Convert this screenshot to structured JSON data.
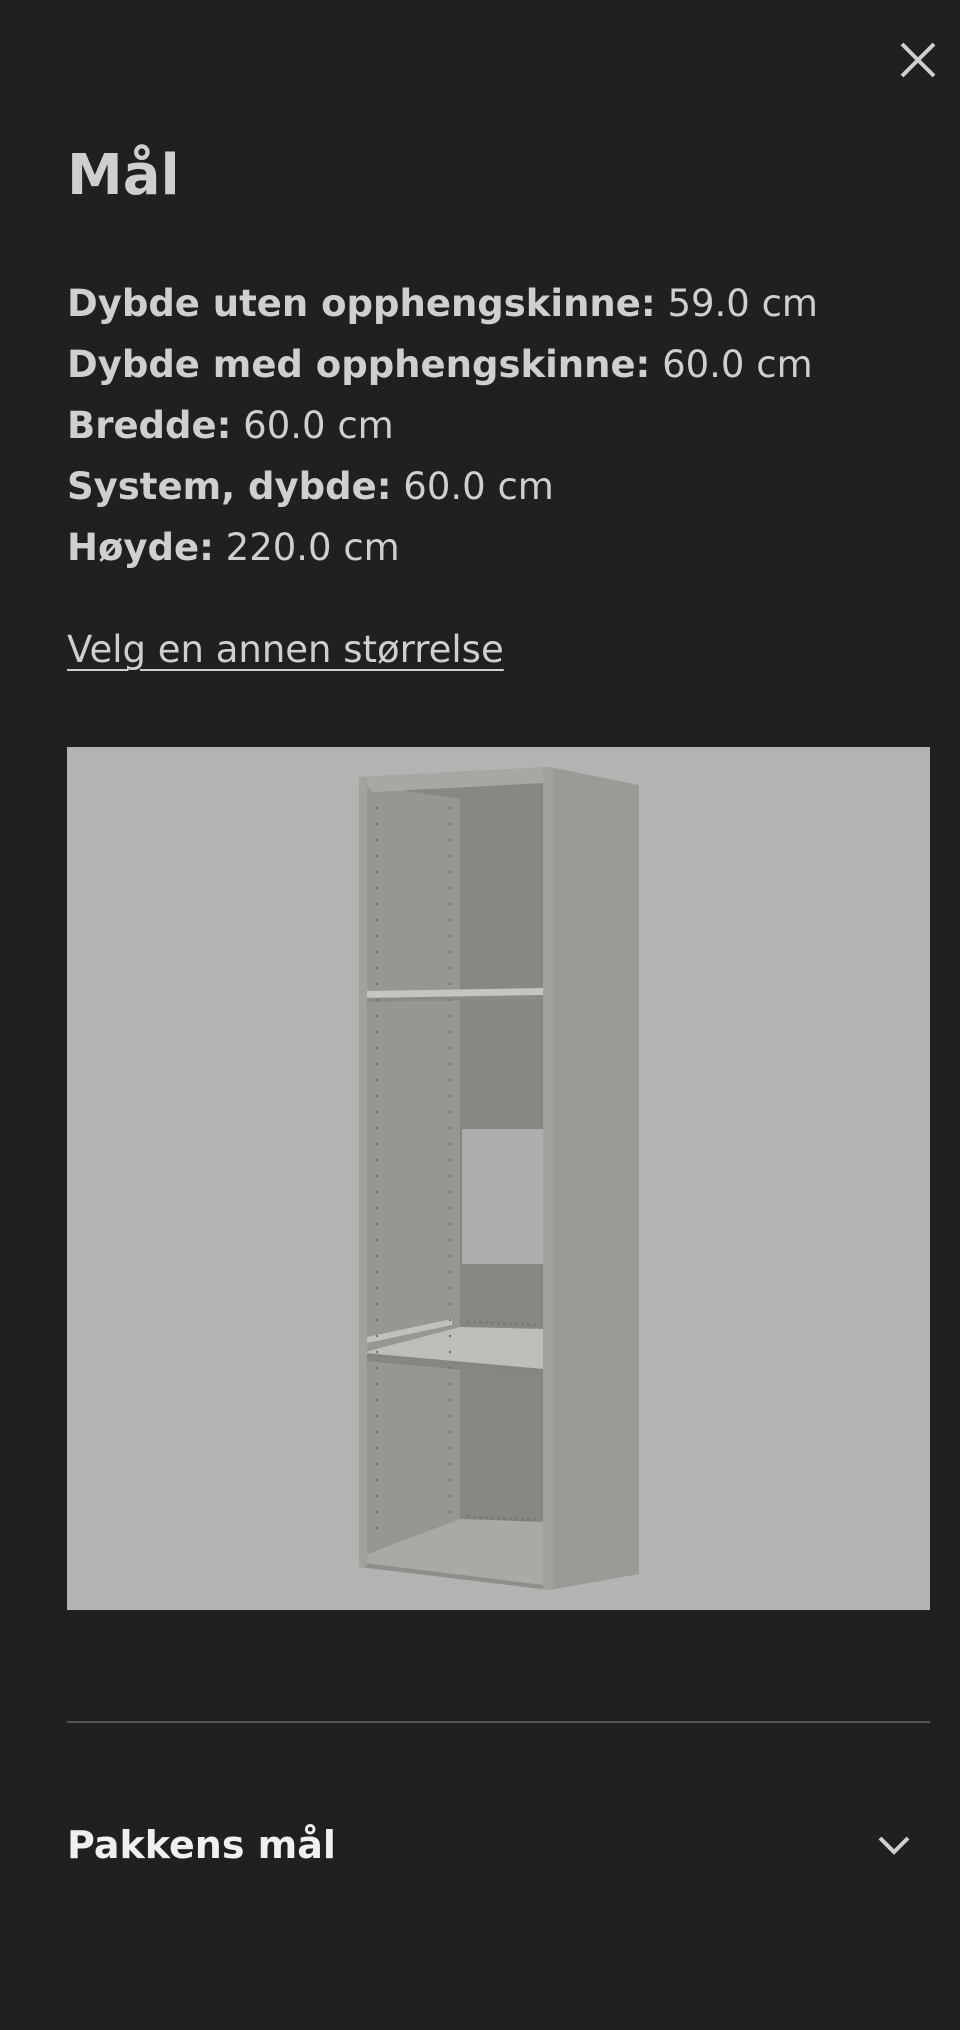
{
  "dialog": {
    "title": "Mål",
    "close_icon": "close-icon"
  },
  "dimensions": [
    {
      "label": "Dybde uten opphengskinne:",
      "value": "59.0 cm"
    },
    {
      "label": "Dybde med opphengskinne:",
      "value": "60.0 cm"
    },
    {
      "label": "Bredde:",
      "value": "60.0 cm"
    },
    {
      "label": "System, dybde:",
      "value": "60.0 cm"
    },
    {
      "label": "Høyde:",
      "value": "220.0 cm"
    }
  ],
  "choose_size_link": "Velg en annen størrelse",
  "package_section": {
    "title": "Pakkens mål",
    "expand_icon": "chevron-down-icon"
  },
  "colors": {
    "background": "#202020",
    "text": "#cfcfcf",
    "image_background": "#b3b3b2"
  }
}
